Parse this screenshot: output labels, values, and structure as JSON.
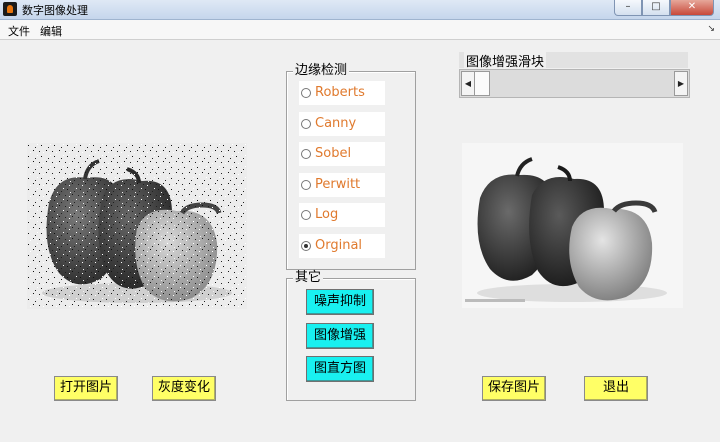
{
  "window": {
    "title": "数字图像处理"
  },
  "window_controls": {
    "minimize": "–",
    "maximize": "□",
    "close": "✕"
  },
  "menu": {
    "items": [
      {
        "label": "文件"
      },
      {
        "label": "编辑"
      }
    ],
    "corner_glyph": "↘"
  },
  "edge_panel": {
    "title": "边缘检测",
    "options": [
      {
        "label": "Roberts",
        "selected": false
      },
      {
        "label": "Canny",
        "selected": false
      },
      {
        "label": "Sobel",
        "selected": false
      },
      {
        "label": "Perwitt",
        "selected": false
      },
      {
        "label": "Log",
        "selected": false
      },
      {
        "label": "Orginal",
        "selected": true
      }
    ],
    "label_color": "#e07a2e"
  },
  "other_panel": {
    "title": "其它",
    "buttons": [
      {
        "label": "噪声抑制"
      },
      {
        "label": "图像增强"
      },
      {
        "label": "图直方图"
      }
    ],
    "button_color": "#19f0f0"
  },
  "slider": {
    "title": "图像增强滑块",
    "value": 0.0
  },
  "left_image": {
    "description_icon": "noisy-pepper-image"
  },
  "right_image": {
    "description_icon": "grayscale-pepper-image"
  },
  "bottom_buttons": {
    "open": "打开图片",
    "gray": "灰度变化",
    "save": "保存图片",
    "exit": "退出",
    "color": "#ffff66"
  }
}
